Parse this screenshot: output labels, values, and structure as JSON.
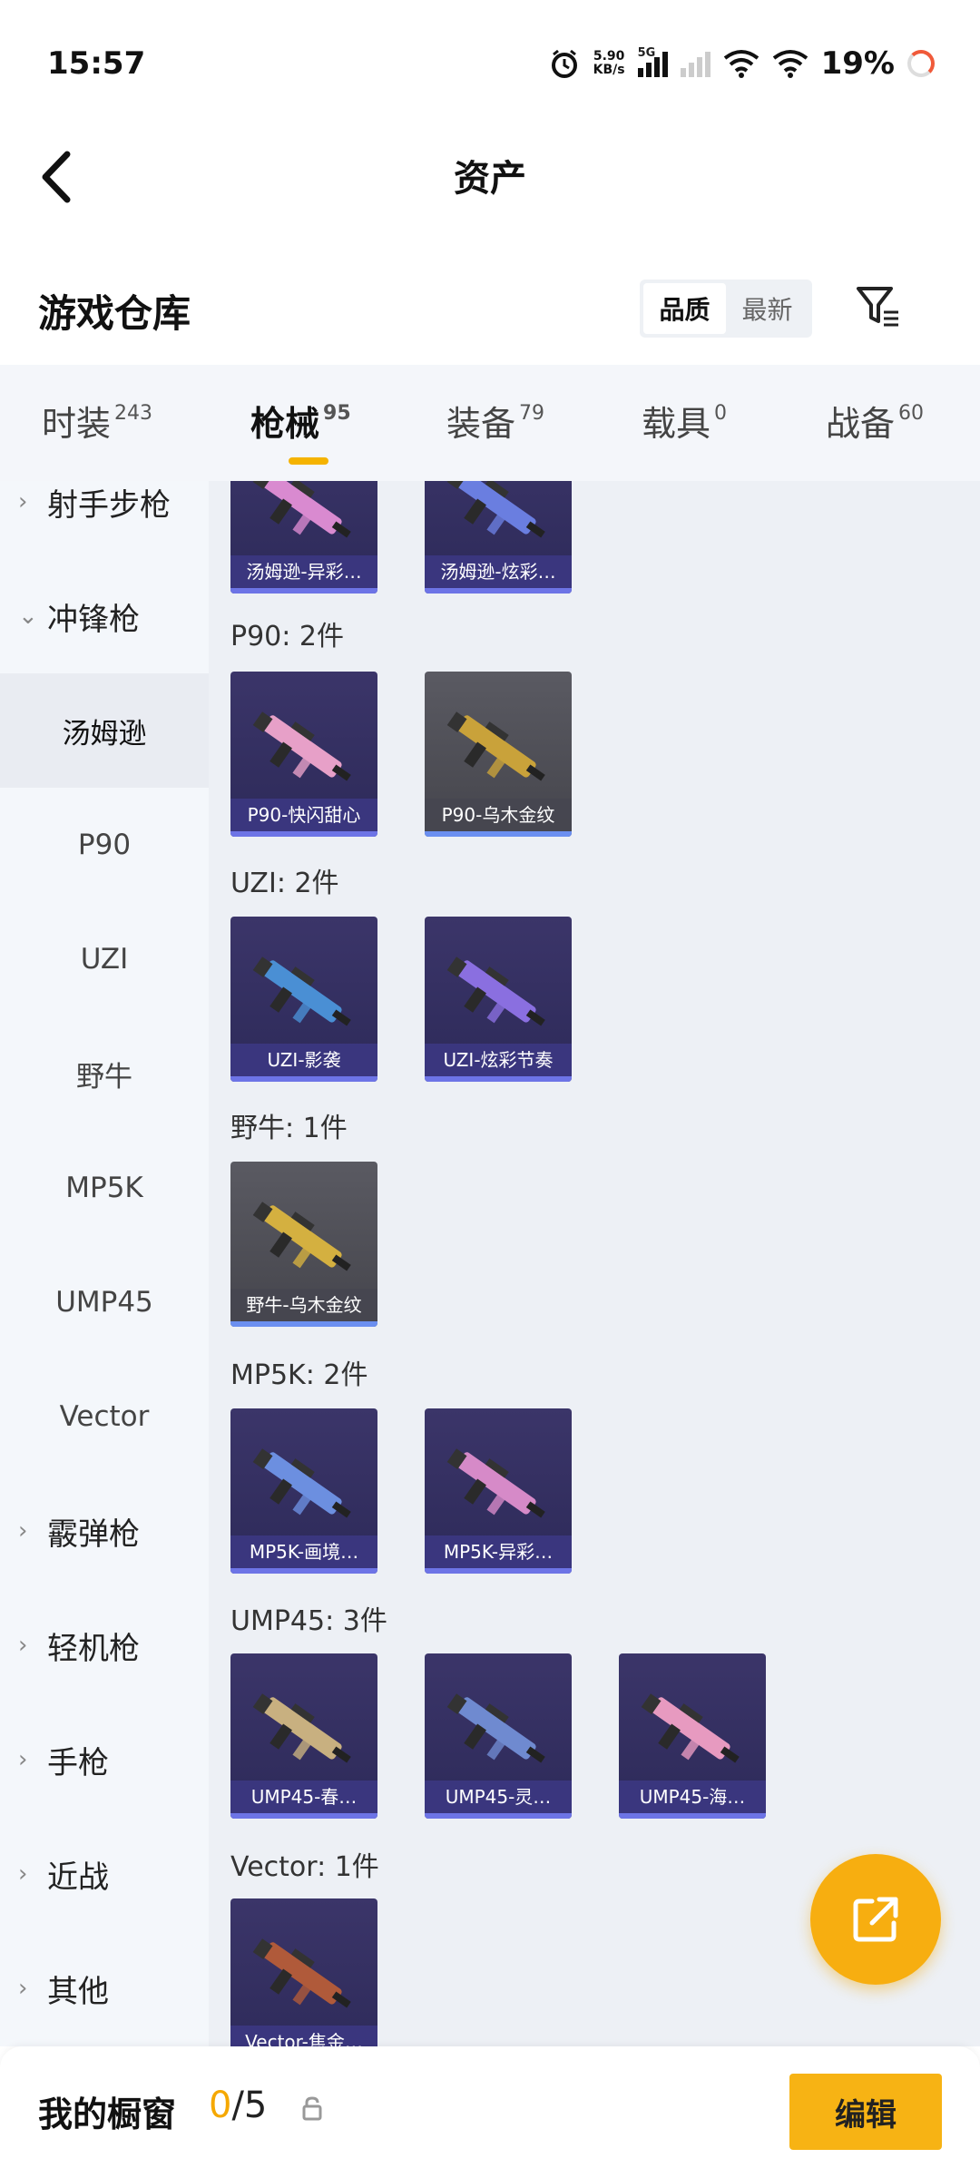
{
  "status_bar": {
    "time": "15:57",
    "net_speed": "5.90",
    "net_unit": "KB/s",
    "network": "5G",
    "battery": "19%"
  },
  "header": {
    "title": "资产"
  },
  "warehouse": {
    "title": "游戏仓库",
    "sort_options": [
      "品质",
      "最新"
    ],
    "sort_selected": "品质"
  },
  "tabs": [
    {
      "label": "时装",
      "count": "243"
    },
    {
      "label": "枪械",
      "count": "95",
      "active": true
    },
    {
      "label": "装备",
      "count": "79"
    },
    {
      "label": "载具",
      "count": "0"
    },
    {
      "label": "战备",
      "count": "60"
    }
  ],
  "sidebar": [
    {
      "label": "射手步枪",
      "type": "parent",
      "chev": "›"
    },
    {
      "label": "冲锋枪",
      "type": "parent",
      "chev": "⌄"
    },
    {
      "label": "汤姆逊",
      "type": "child",
      "selected": true
    },
    {
      "label": "P90",
      "type": "child"
    },
    {
      "label": "UZI",
      "type": "child"
    },
    {
      "label": "野牛",
      "type": "child"
    },
    {
      "label": "MP5K",
      "type": "child"
    },
    {
      "label": "UMP45",
      "type": "child"
    },
    {
      "label": "Vector",
      "type": "child"
    },
    {
      "label": "霰弹枪",
      "type": "parent",
      "chev": "›"
    },
    {
      "label": "轻机枪",
      "type": "parent",
      "chev": "›"
    },
    {
      "label": "手枪",
      "type": "parent",
      "chev": "›"
    },
    {
      "label": "近战",
      "type": "parent",
      "chev": "›"
    },
    {
      "label": "其他",
      "type": "parent",
      "chev": "›"
    }
  ],
  "groups": [
    {
      "title": "",
      "items": [
        {
          "label": "汤姆逊-异彩…",
          "tone": "purple",
          "gun": "#d98ad0"
        },
        {
          "label": "汤姆逊-炫彩…",
          "tone": "purple",
          "gun": "#6a7ee0"
        }
      ]
    },
    {
      "title": "P90: 2件",
      "items": [
        {
          "label": "P90-快闪甜心",
          "tone": "purple",
          "gun": "#e7a0c8"
        },
        {
          "label": "P90-乌木金纹",
          "tone": "gold",
          "gun": "#c9a23a"
        }
      ]
    },
    {
      "title": "UZI: 2件",
      "items": [
        {
          "label": "UZI-影袭",
          "tone": "purple",
          "gun": "#4a8fd4"
        },
        {
          "label": "UZI-炫彩节奏",
          "tone": "purple",
          "gun": "#8a6fe0"
        }
      ]
    },
    {
      "title": "野牛: 1件",
      "items": [
        {
          "label": "野牛-乌木金纹",
          "tone": "gold",
          "gun": "#d4b040"
        }
      ]
    },
    {
      "title": "MP5K: 2件",
      "items": [
        {
          "label": "MP5K-画境…",
          "tone": "purple",
          "gun": "#6c8fe0"
        },
        {
          "label": "MP5K-异彩…",
          "tone": "purple",
          "gun": "#d68ac8"
        }
      ]
    },
    {
      "title": "UMP45: 3件",
      "items": [
        {
          "label": "UMP45-春…",
          "tone": "purple",
          "gun": "#c8b080"
        },
        {
          "label": "UMP45-灵…",
          "tone": "purple",
          "gun": "#6f8ad0"
        },
        {
          "label": "UMP45-海…",
          "tone": "purple",
          "gun": "#e79ac0"
        }
      ]
    },
    {
      "title": "Vector: 1件",
      "items": [
        {
          "label": "Vector-焦金…",
          "tone": "purple",
          "gun": "#b05a3a"
        }
      ]
    }
  ],
  "bottom": {
    "title": "我的橱窗",
    "current": "0",
    "total": "/5",
    "edit_label": "编辑"
  },
  "icons": {
    "back": "back-arrow-icon",
    "filter": "filter-icon",
    "share": "share-icon",
    "lock": "lock-icon"
  },
  "colors": {
    "accent": "#f7b314",
    "tab_indicator": "#f5b300",
    "card_label": "#3c3782"
  }
}
